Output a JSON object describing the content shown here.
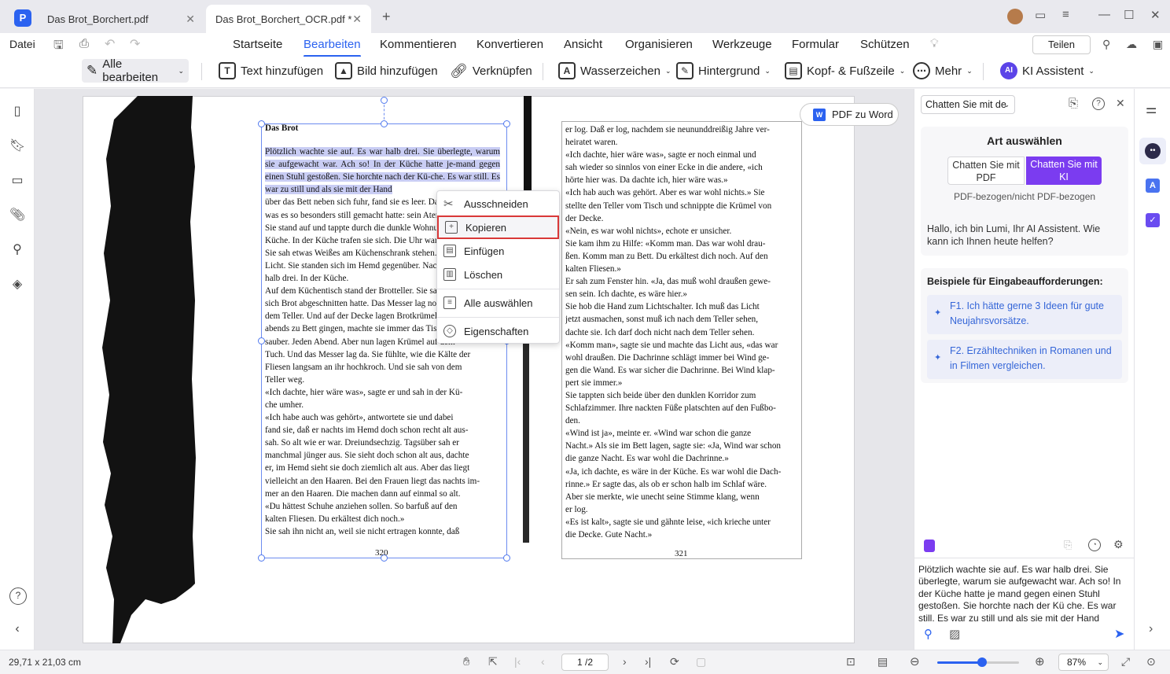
{
  "tabs": [
    {
      "title": "Das Brot_Borchert.pdf"
    },
    {
      "title": "Das Brot_Borchert_OCR.pdf *"
    }
  ],
  "menu": {
    "file": "Datei",
    "items": [
      "Startseite",
      "Bearbeiten",
      "Kommentieren",
      "Konvertieren",
      "Ansicht",
      "Organisieren",
      "Werkzeuge",
      "Formular",
      "Schützen"
    ],
    "share": "Teilen"
  },
  "toolbar": {
    "edit_all": "Alle bearbeiten",
    "add_text": "Text hinzufügen",
    "add_image": "Bild hinzufügen",
    "link": "Verknüpfen",
    "watermark": "Wasserzeichen",
    "background": "Hintergrund",
    "header_footer": "Kopf- & Fußzeile",
    "more": "Mehr",
    "ai": "KI Assistent"
  },
  "document": {
    "pdf_to_word": "PDF zu Word",
    "left_title": "Das Brot",
    "left_highlight": "Plötzlich wachte sie auf. Es war halb drei. Sie überlegte, warum sie aufgewacht war. Ach so! In der Küche hatte je-mand gegen einen Stuhl gestoßen. Sie horchte nach der Kü-che. Es war still. Es war zu still und als sie mit der Hand",
    "left_lines": [
      "über das Bett neben sich fuhr, fand sie es leer. Das",
      "was es so besonders still gemacht hatte: sein Atem",
      "Sie stand auf und tappte durch die dunkle Wohnung zur",
      "Küche. In der Küche trafen sie sich. Die Uhr war halb drei.",
      "Sie sah etwas Weißes am Küchenschrank stehen. Sie machte",
      "Licht. Sie standen sich im Hemd gegenüber. Nachts. Um",
      "halb drei. In der Küche.",
      "Auf dem Küchentisch stand der Brotteller. Sie sah, daß er",
      "sich Brot abgeschnitten hatte. Das Messer lag noch neben",
      "dem Teller. Und auf der Decke lagen Brotkrümel. Wenn sie",
      "abends zu Bett gingen, machte sie immer das Tischtuch",
      "sauber. Jeden Abend. Aber nun lagen Krümel auf dem",
      "Tuch. Und das Messer lag da. Sie fühlte, wie die Kälte der",
      "Fliesen langsam an ihr hochkroch. Und sie sah von dem",
      "Teller weg.",
      "«Ich dachte, hier wäre was», sagte er und sah in der Kü-",
      "che umher.",
      "«Ich habe auch was gehört», antwortete sie und dabei",
      "fand sie, daß er nachts im Hemd doch schon recht alt aus-",
      "sah. So alt wie er war. Dreiundsechzig. Tagsüber sah er",
      "manchmal jünger aus. Sie sieht doch schon alt aus, dachte",
      "er, im Hemd sieht sie doch ziemlich alt aus. Aber das liegt",
      "vielleicht an den Haaren. Bei den Frauen liegt das nachts im-",
      "mer an den Haaren. Die machen dann auf einmal so alt.",
      "«Du hättest Schuhe anziehen sollen. So barfuß auf den",
      "kalten Fliesen. Du erkältest dich noch.»",
      "Sie sah ihn nicht an, weil sie nicht ertragen konnte, daß"
    ],
    "left_page_number": "320",
    "right_lines": [
      "er log. Daß er log, nachdem sie neununddreißig Jahre ver-",
      "heiratet waren.",
      "«Ich dachte, hier wäre was», sagte er noch einmal und",
      "sah wieder so sinnlos von einer Ecke in die andere, «ich",
      "hörte hier was. Da dachte ich, hier wäre was.»",
      "«Ich hab auch was gehört. Aber es war wohl nichts.» Sie",
      "stellte den Teller vom Tisch und schnippte die Krümel von",
      "der Decke.",
      "«Nein, es war wohl nichts», echote er unsicher.",
      "Sie kam ihm zu Hilfe: «Komm man. Das war wohl drau-",
      "ßen. Komm man zu Bett. Du erkältest dich noch. Auf den",
      "kalten Fliesen.»",
      "Er sah zum Fenster hin. «Ja, das muß wohl draußen gewe-",
      "sen sein. Ich dachte, es wäre hier.»",
      "Sie hob die Hand zum Lichtschalter. Ich muß das Licht",
      "jetzt ausmachen, sonst muß ich nach dem Teller sehen,",
      "dachte sie. Ich darf doch nicht nach dem Teller sehen.",
      "«Komm man», sagte sie und machte das Licht aus, «das war",
      "wohl draußen. Die Dachrinne schlägt immer bei Wind ge-",
      "gen die Wand. Es war sicher die Dachrinne. Bei Wind klap-",
      "pert sie immer.»",
      "Sie tappten sich beide über den dunklen Korridor zum",
      "Schlafzimmer. Ihre nackten Füße platschten auf den Fußbo-",
      "den.",
      "«Wind ist ja», meinte er. «Wind war schon die ganze",
      "Nacht.» Als sie im Bett lagen, sagte sie: «Ja, Wind war schon",
      "die ganze Nacht. Es war wohl die Dachrinne.»",
      "«Ja, ich dachte, es wäre in der Küche. Es war wohl die Dach-",
      "rinne.» Er sagte das, als ob er schon halb im Schlaf wäre.",
      "Aber sie merkte, wie unecht seine Stimme klang, wenn",
      "er log.",
      "«Es ist kalt», sagte sie und gähnte leise, «ich krieche unter",
      "die Decke. Gute Nacht.»"
    ],
    "right_page_number": "321"
  },
  "context_menu": {
    "cut": "Ausschneiden",
    "copy": "Kopieren",
    "paste": "Einfügen",
    "delete": "Löschen",
    "select_all": "Alle auswählen",
    "properties": "Eigenschaften"
  },
  "ai_panel": {
    "dropdown": "Chatten Sie mit de",
    "heading": "Art auswählen",
    "opt_pdf": "Chatten Sie mit PDF",
    "opt_ai": "Chatten Sie mit KI",
    "subtitle": "PDF-bezogen/nicht PDF-bezogen",
    "greeting": "Hallo, ich bin Lumi, Ihr AI Assistent. Wie kann ich Ihnen heute helfen?",
    "examples_heading": "Beispiele für Eingabeaufforderungen:",
    "prompt1": "F1. Ich hätte gerne 3 Ideen für gute Neujahrsvorsätze.",
    "prompt2": "F2. Erzähltechniken in Romanen und in Filmen vergleichen.",
    "input_text": "Plötzlich  wachte sie auf.  Es war halb  drei.  Sie überlegte, warum sie aufgewacht war. Ach so! In der Küche hatte je mand gegen einen Stuhl gestoßen. Sie horchte nach der Kü che. Es war still. Es war zu still und als sie mit der Hand"
  },
  "status": {
    "dimensions": "29,71 x 21,03 cm",
    "page": "1 /2",
    "zoom": "87%",
    "zoom_level": 0.55
  },
  "colors": {
    "accent": "#2b62f0",
    "ai_purple": "#7b3cf0",
    "highlight": "#c9cdf4",
    "focus_border": "#d93838"
  }
}
